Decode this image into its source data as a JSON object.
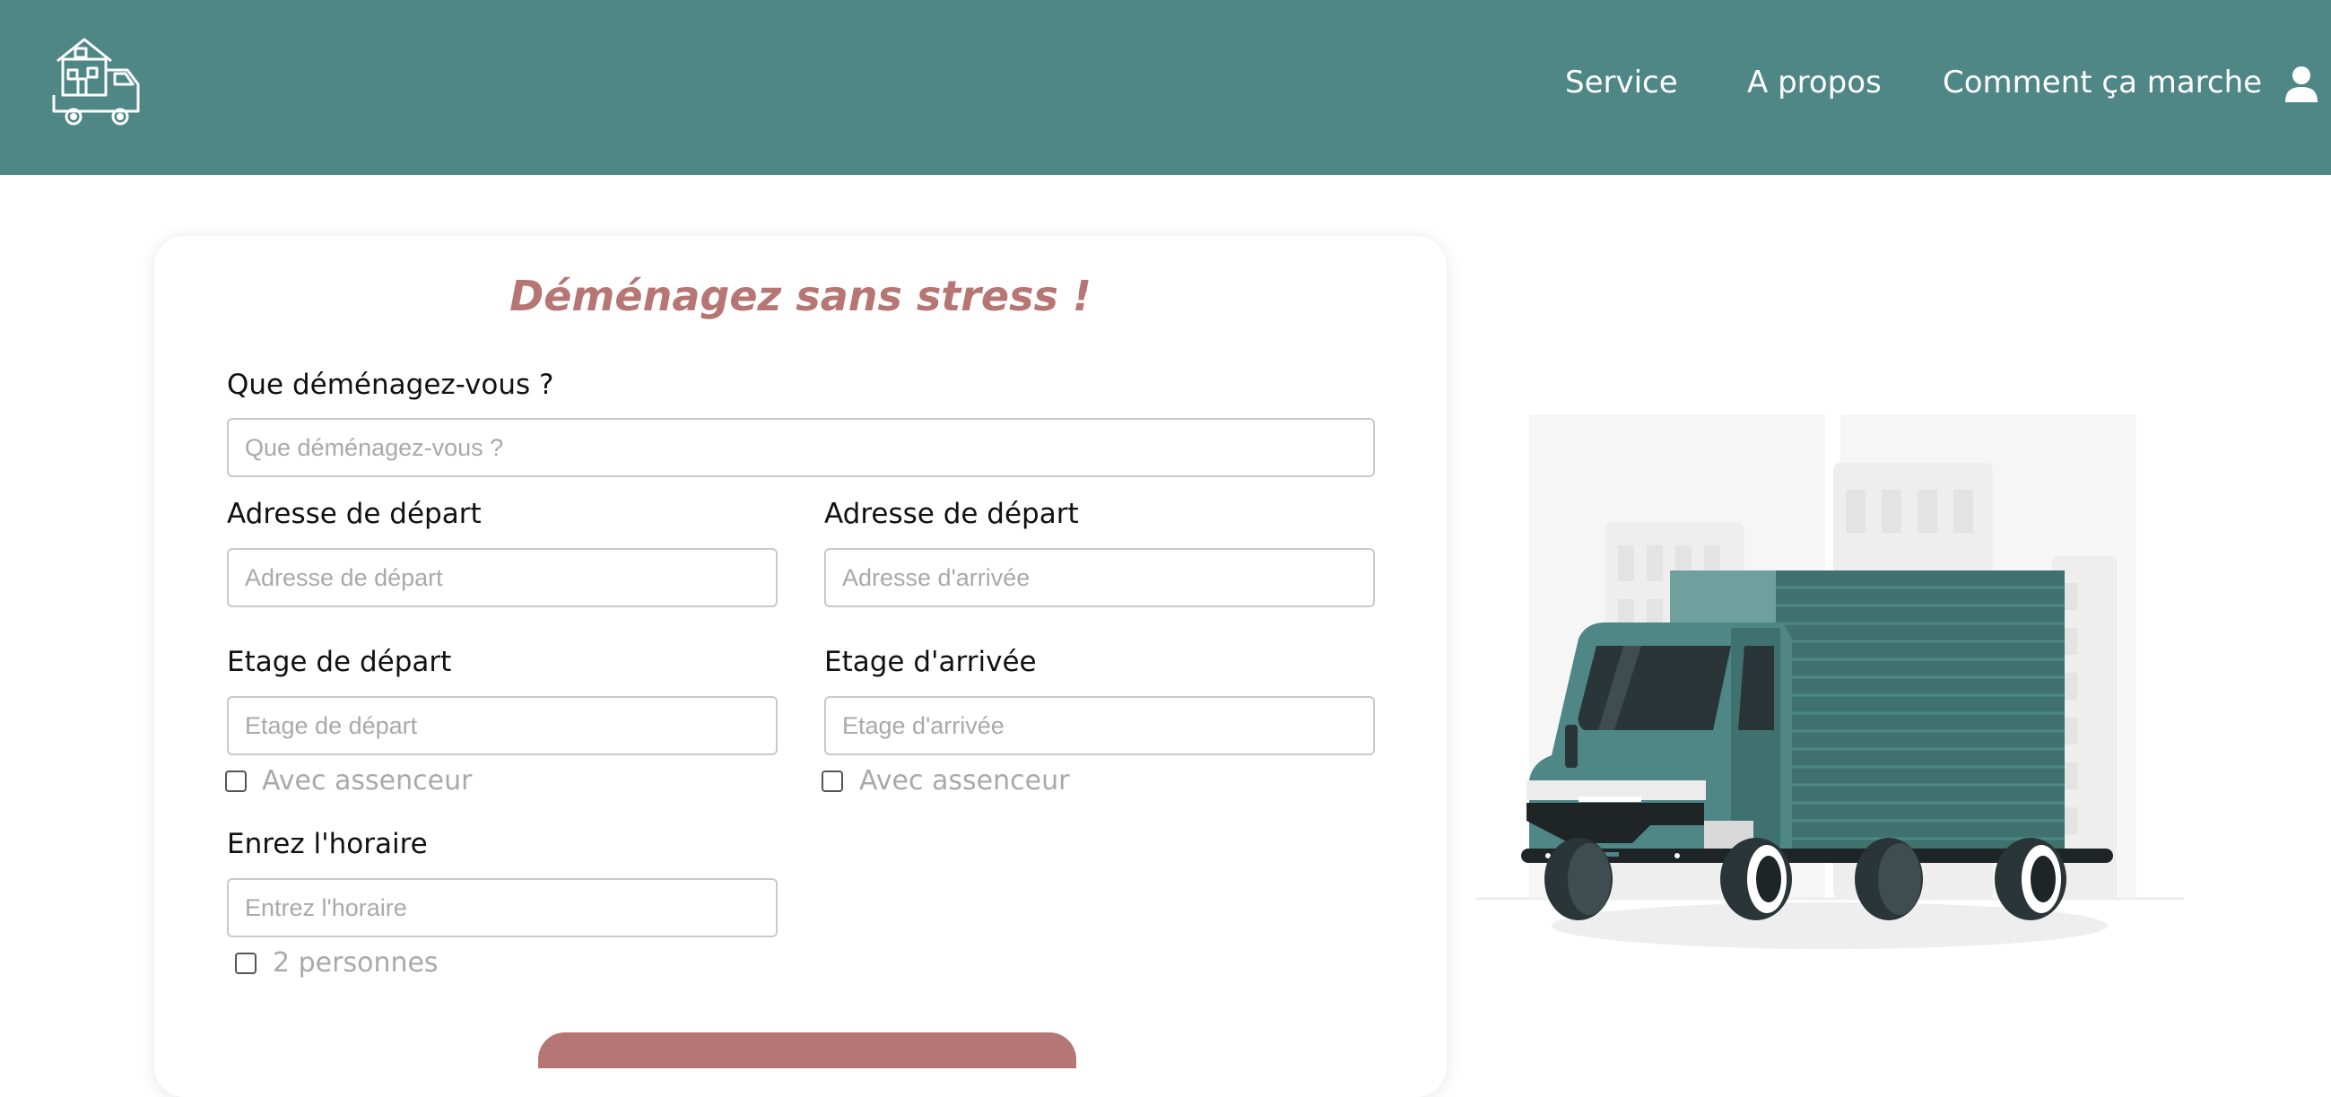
{
  "header": {
    "logo_icon": "moving-truck-house-logo",
    "nav": [
      {
        "label": "Service"
      },
      {
        "label": "A propos"
      },
      {
        "label": "Comment ça marche"
      }
    ],
    "user_icon": "user-icon",
    "colors": {
      "background": "#4e8785",
      "text": "#ffffff"
    }
  },
  "form": {
    "title": "Déménagez sans stress !",
    "what": {
      "label": "Que déménagez-vous ?",
      "placeholder": "Que déménagez-vous ?"
    },
    "departure_address": {
      "label": "Adresse de départ",
      "placeholder": "Adresse de départ"
    },
    "arrival_address": {
      "label": "Adresse de départ",
      "placeholder": "Adresse d'arrivée"
    },
    "departure_floor": {
      "label": "Etage de départ",
      "placeholder": "Etage de départ",
      "elevator_label": "Avec assenceur"
    },
    "arrival_floor": {
      "label": "Etage d'arrivée",
      "placeholder": "Etage d'arrivée",
      "elevator_label": "Avec assenceur"
    },
    "schedule": {
      "label": "Enrez l'horaire",
      "placeholder": "Entrez l'horaire"
    },
    "two_people_label": "2 personnes",
    "colors": {
      "title": "#b67673",
      "field_border": "#c9c9c9",
      "placeholder": "#a9a9a9"
    }
  },
  "illustration": {
    "icon": "delivery-truck-city-illustration"
  }
}
